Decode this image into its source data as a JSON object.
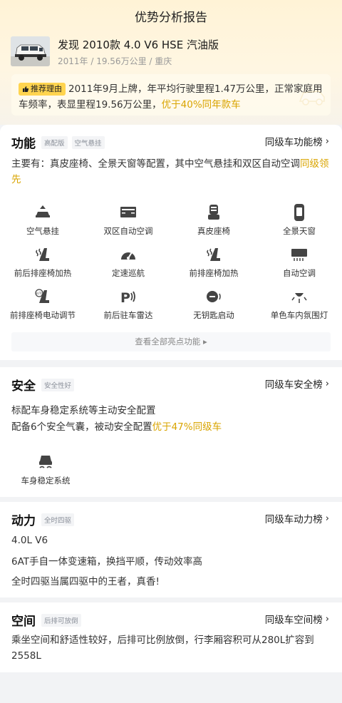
{
  "header": {
    "title": "优势分析报告"
  },
  "car": {
    "name": "发现 2010款 4.0 V6 HSE 汽油版",
    "meta": "2011年 / 19.56万公里 / 重庆"
  },
  "recommend": {
    "badge": "推荐理由",
    "text": "2011年9月上牌，年平均行驶里程1.47万公里，正常家庭用车频率，表显里程19.56万公里，",
    "highlight": "优于40%同年款车"
  },
  "features": {
    "title": "功能",
    "tags": [
      "高配版",
      "空气悬挂"
    ],
    "rank_link": "同级车功能榜",
    "desc": "主要有：真皮座椅、全景天窗等配置，其中空气悬挂和双区自动空调",
    "desc_highlight": "同级领先",
    "items": [
      {
        "label": "空气悬挂",
        "icon": "air-suspension-icon"
      },
      {
        "label": "双区自动空调",
        "icon": "dual-zone-ac-icon"
      },
      {
        "label": "真皮座椅",
        "icon": "leather-seat-icon"
      },
      {
        "label": "全景天窗",
        "icon": "panoramic-sunroof-icon"
      },
      {
        "label": "前后排座椅加热",
        "icon": "seat-heating-icon"
      },
      {
        "label": "定速巡航",
        "icon": "cruise-control-icon"
      },
      {
        "label": "前排座椅加热",
        "icon": "seat-heating-icon"
      },
      {
        "label": "自动空调",
        "icon": "auto-ac-icon"
      },
      {
        "label": "前排座椅电动调节",
        "icon": "power-seat-icon"
      },
      {
        "label": "前后驻车雷达",
        "icon": "parking-radar-icon"
      },
      {
        "label": "无钥匙启动",
        "icon": "keyless-start-icon"
      },
      {
        "label": "单色车内氛围灯",
        "icon": "ambient-light-icon"
      }
    ],
    "view_all": "查看全部亮点功能"
  },
  "safety": {
    "title": "安全",
    "tag": "安全性好",
    "rank_link": "同级车安全榜",
    "line1": "标配车身稳定系统等主动安全配置",
    "line2": "配备6个安全气囊，被动安全配置",
    "line2_highlight": "优于47%同级车",
    "item": {
      "label": "车身稳定系统",
      "icon": "stability-control-icon"
    }
  },
  "power": {
    "title": "动力",
    "tag": "全时四驱",
    "rank_link": "同级车动力榜",
    "lines": [
      "4.0L V6",
      "6AT手自一体变速箱，换挡平顺，传动效率高",
      "全时四驱当属四驱中的王者，真香!"
    ]
  },
  "space": {
    "title": "空间",
    "tag": "后排可放倒",
    "rank_link": "同级车空间榜",
    "desc": "乘坐空间和舒适性较好，后排可比例放倒，行李厢容积可从280L扩容到2558L"
  },
  "colors": {
    "accent": "#d9a400",
    "badge": "#ffd44f"
  }
}
